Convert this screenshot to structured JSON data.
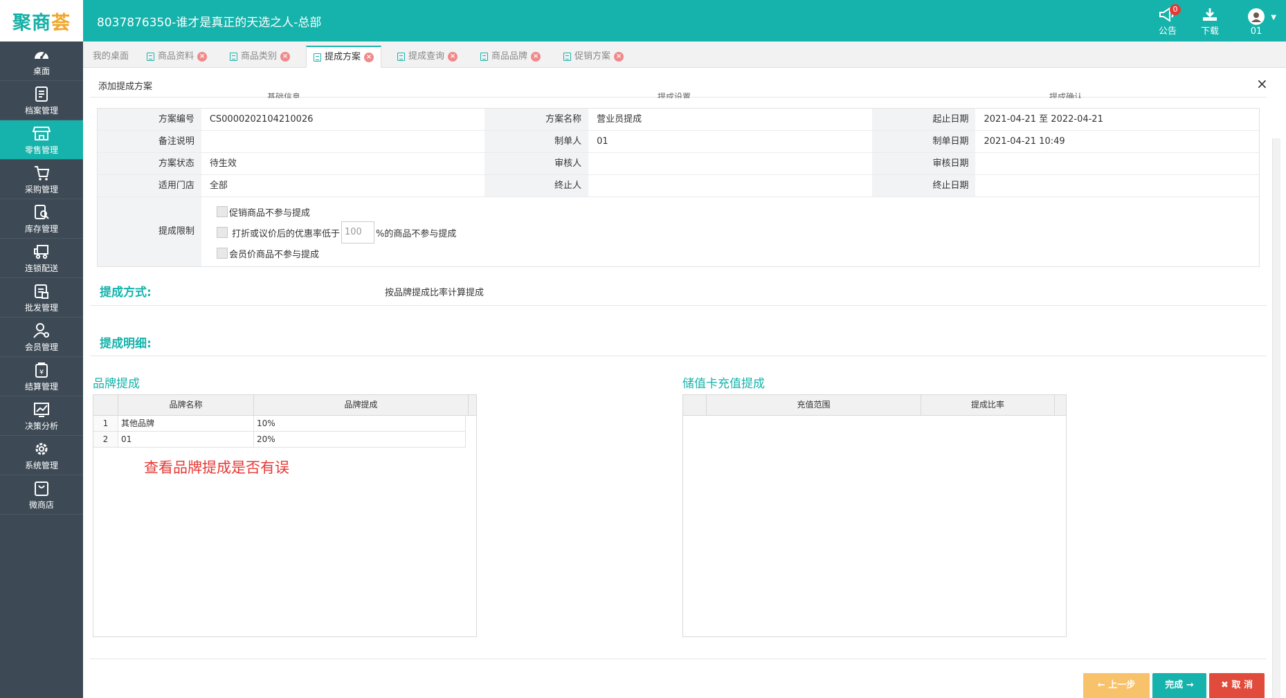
{
  "header": {
    "logo_main": "聚商",
    "logo_accent": "荟",
    "title": "8037876350-谁才是真正的天选之人-总部",
    "notice_label": "公告",
    "notice_count": "0",
    "download_label": "下载",
    "user_label": "01"
  },
  "sidebar": {
    "items": [
      {
        "label": "桌面",
        "icon": "dashboard-icon"
      },
      {
        "label": "档案管理",
        "icon": "archive-icon"
      },
      {
        "label": "零售管理",
        "icon": "store-icon"
      },
      {
        "label": "采购管理",
        "icon": "purchase-icon"
      },
      {
        "label": "库存管理",
        "icon": "inventory-icon"
      },
      {
        "label": "连锁配送",
        "icon": "truck-icon"
      },
      {
        "label": "批发管理",
        "icon": "wholesale-icon"
      },
      {
        "label": "会员管理",
        "icon": "member-icon"
      },
      {
        "label": "结算管理",
        "icon": "settlement-icon"
      },
      {
        "label": "决策分析",
        "icon": "chart-icon"
      },
      {
        "label": "系统管理",
        "icon": "gear-icon"
      },
      {
        "label": "微商店",
        "icon": "bag-icon"
      }
    ],
    "active_index": 2
  },
  "tabs": [
    {
      "label": "我的桌面"
    },
    {
      "label": "商品资料"
    },
    {
      "label": "商品类别"
    },
    {
      "label": "提成方案"
    },
    {
      "label": "提成查询"
    },
    {
      "label": "商品品牌"
    },
    {
      "label": "促销方案"
    }
  ],
  "dialog": {
    "title": "添加提成方案",
    "close": "×",
    "steps": [
      "基础信息",
      "提成设置",
      "提成确认"
    ]
  },
  "form": {
    "rows": [
      [
        {
          "label": "方案编号",
          "value": "CS0000202104210026"
        },
        {
          "label": "方案名称",
          "value": "营业员提成"
        },
        {
          "label": "起止日期",
          "value": "2021-04-21 至 2022-04-21"
        }
      ],
      [
        {
          "label": "备注说明",
          "value": ""
        },
        {
          "label": "制单人",
          "value": "01"
        },
        {
          "label": "制单日期",
          "value": "2021-04-21 10:49"
        }
      ],
      [
        {
          "label": "方案状态",
          "value": "待生效"
        },
        {
          "label": "审核人",
          "value": ""
        },
        {
          "label": "审核日期",
          "value": ""
        }
      ],
      [
        {
          "label": "适用门店",
          "value": "全部"
        },
        {
          "label": "终止人",
          "value": ""
        },
        {
          "label": "终止日期",
          "value": ""
        }
      ]
    ],
    "limit_label": "提成限制",
    "check_promo": "促销商品不参与提成",
    "check_discount_pre": "打折或议价后的优惠率低于",
    "discount_value": "100",
    "check_discount_post": "%的商品不参与提成",
    "check_member": "会员价商品不参与提成"
  },
  "method": {
    "title": "提成方式:",
    "value": "按品牌提成比率计算提成"
  },
  "detail": {
    "title": "提成明细:"
  },
  "brand": {
    "title": "品牌提成",
    "columns": [
      "品牌名称",
      "品牌提成"
    ],
    "rows": [
      {
        "no": "1",
        "name": "其他品牌",
        "rate": "10%"
      },
      {
        "no": "2",
        "name": "01",
        "rate": "20%"
      }
    ],
    "note": "查看品牌提成是否有误"
  },
  "card": {
    "title": "储值卡充值提成",
    "columns": [
      "充值范围",
      "提成比率"
    ]
  },
  "buttons": {
    "prev": "上一步",
    "done": "完成",
    "cancel": "取 消"
  },
  "colors": {
    "primary": "#15b3ab",
    "sidebar": "#3d4a55",
    "prev": "#f8c26a",
    "done": "#15b3ab",
    "cancel": "#e14b3b",
    "note": "#e53935"
  }
}
